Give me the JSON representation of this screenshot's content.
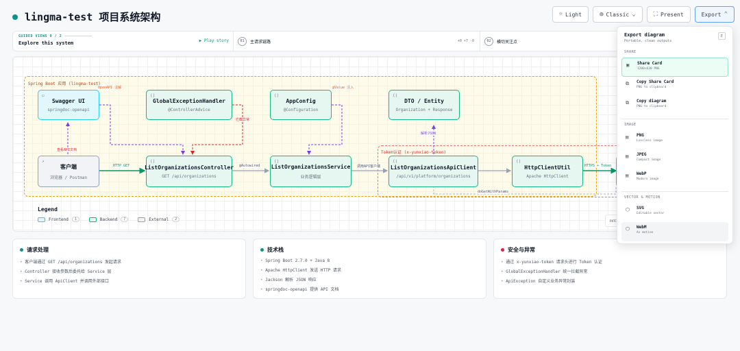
{
  "header": {
    "title": "lingma-test 项目系统架构",
    "buttons": {
      "light": "Light",
      "classic": "Classic",
      "present": "Present",
      "export": "Export"
    }
  },
  "guided": {
    "label": "GUIDED VIEWS 0 / 2",
    "subtitle": "Explore this system",
    "play": "▶ Play story",
    "steps": [
      {
        "num": "01",
        "text": "主请求链路",
        "diff": "+0 +7 -0"
      },
      {
        "num": "02",
        "text": "横切关注点"
      }
    ]
  },
  "diagram": {
    "zone_spring": "Spring Boot 应用 (lingma-test)",
    "zone_token": "Token认证 (x-yunxiao-token)",
    "nodes": {
      "swagger": {
        "title": "Swagger UI",
        "sub": "springdoc-openapi"
      },
      "handler": {
        "title": "GlobalExceptionHandler",
        "sub": "@ControllerAdvice"
      },
      "appconfig": {
        "title": "AppConfig",
        "sub": "@Configuration"
      },
      "dto": {
        "title": "DTO / Entity",
        "sub": "Organization + Response"
      },
      "client": {
        "title": "客户端",
        "sub": "浏览器 / Postman"
      },
      "controller": {
        "title": "ListOrganizationsController",
        "sub": "GET /api/organizations"
      },
      "service": {
        "title": "ListOrganizationsService",
        "sub": "业务逻辑层"
      },
      "apiclient": {
        "title": "ListOrganizationsApiClient",
        "sub": "/api/v1/platform/organizations"
      },
      "httpclient": {
        "title": "HttpClientUtil",
        "sub": "Apache HttpClient"
      }
    },
    "edges": {
      "openapi": "OpenAPI 注解",
      "value": "@Value 注入",
      "intercept": "拦截异常",
      "parse": "解析JSON",
      "docs": "查看API文档",
      "http_get": "HTTP GET",
      "autowired": "@Autowired",
      "call_api": "调用API客户端",
      "https": "HTTPS + Token",
      "doget": "doGetWithParams"
    },
    "legend": {
      "title": "Legend",
      "items": [
        {
          "label": "Frontend",
          "count": "1"
        },
        {
          "label": "Backend",
          "count": "7"
        },
        {
          "label": "External",
          "count": "2"
        }
      ]
    },
    "patch": "PATC"
  },
  "cards": [
    {
      "title": "请求处理",
      "color": "#0d9488",
      "items": [
        "客户端通过 GET /api/organizations 发起请求",
        "Controller 接收参数后委托给 Service 层",
        "Service 调用 ApiClient 并调用外部接口"
      ]
    },
    {
      "title": "技术栈",
      "color": "#0d9488",
      "items": [
        "Spring Boot 2.7.0 + Java 8",
        "Apache HttpClient 发送 HTTP 请求",
        "Jackson 解析 JSON 响应",
        "springdoc-openapi 提供 API 文档"
      ]
    },
    {
      "title": "安全与异常",
      "color": "#e11d48",
      "items": [
        "通过 x-yunxiao-token 请求头进行 Token 认证",
        "GlobalExceptionHandler 统一拦截异常",
        "ApiException 自定义业务异常封装"
      ]
    }
  ],
  "export_menu": {
    "title": "Export diagram",
    "subtitle": "Portable, clean outputs",
    "close": "E",
    "sections": {
      "share": "SHARE",
      "image": "IMAGE",
      "vector": "VECTOR & MOTION"
    },
    "share_items": [
      {
        "label": "Share Card",
        "desc": "1200×630 PNG"
      },
      {
        "label": "Copy Share Card",
        "desc": "PNG to clipboard"
      },
      {
        "label": "Copy diagram",
        "desc": "PNG to clipboard"
      }
    ],
    "image_items": [
      {
        "label": "PNG",
        "desc": "Lossless image"
      },
      {
        "label": "JPEG",
        "desc": "Compact image"
      },
      {
        "label": "WebP",
        "desc": "Modern image"
      }
    ],
    "vector_items": [
      {
        "label": "SVG",
        "desc": "Editable vector"
      },
      {
        "label": "WebM",
        "desc": "As motion"
      }
    ]
  }
}
